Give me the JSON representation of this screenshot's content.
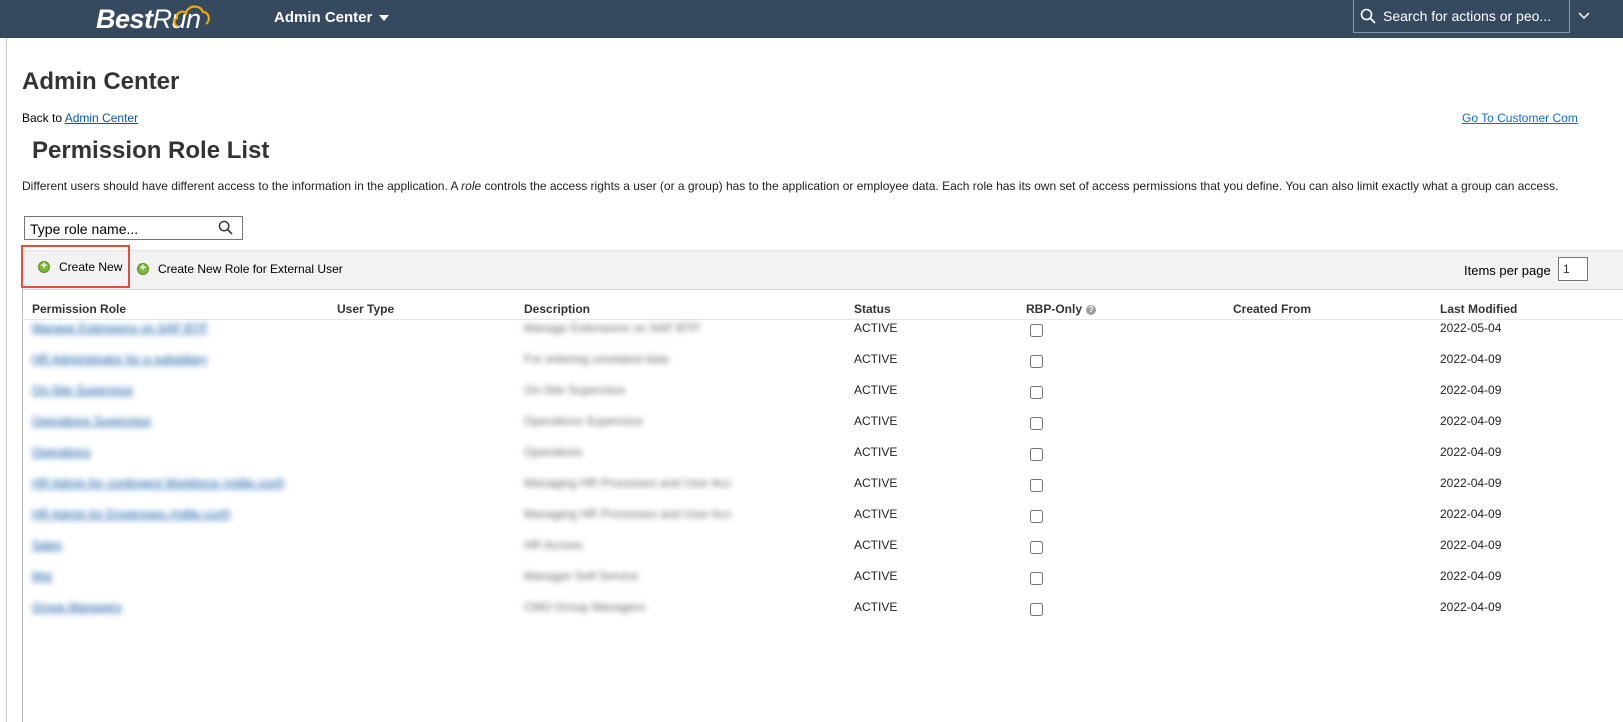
{
  "shell": {
    "logo_text_1": "Best",
    "logo_text_2": "Run",
    "app_title": "Admin Center",
    "search_placeholder": "Search for actions or peo..."
  },
  "page": {
    "heading": "Admin Center",
    "back_prefix": "Back to",
    "back_link": "Admin Center",
    "customer_link": "Go To Customer Com",
    "list_title": "Permission Role List",
    "intro_part1": "Different users should have different access to the information in the application. A ",
    "intro_italic": "role",
    "intro_part2": " controls the access rights a user (or a group) has to the application or employee data. Each role has its own set of access permissions that you define. You can also limit exactly what a group can access."
  },
  "role_search": {
    "placeholder": "Type role name..."
  },
  "toolbar": {
    "create_new": "Create New",
    "create_new_external": "Create New Role for External User",
    "items_per_page_label": "Items per page",
    "items_per_page_value": "1"
  },
  "table": {
    "columns": [
      "Permission Role",
      "User Type",
      "Description",
      "Status",
      "RBP-Only",
      "Created From",
      "Last Modified"
    ],
    "rows": [
      {
        "role": "Manage Extensions on SAP BTP",
        "description": "Manage Extensions on SAP BTP",
        "status": "ACTIVE",
        "rbp_only": false,
        "last_modified": "2022-05-04"
      },
      {
        "role": "HR Administrator for a subsidiary",
        "description": "For entering unrelated data",
        "status": "ACTIVE",
        "rbp_only": false,
        "last_modified": "2022-04-09"
      },
      {
        "role": "On-Site Supervisor",
        "description": "On-Site Supervisor",
        "status": "ACTIVE",
        "rbp_only": false,
        "last_modified": "2022-04-09"
      },
      {
        "role": "Operations Supervisor",
        "description": "Operations Supervisor",
        "status": "ACTIVE",
        "rbp_only": false,
        "last_modified": "2022-04-09"
      },
      {
        "role": "Operations",
        "description": "Operations",
        "status": "ACTIVE",
        "rbp_only": false,
        "last_modified": "2022-04-09"
      },
      {
        "role": "HR Admin for contingent Workforce (millip conf)",
        "description": "Managing HR Processes and User Acc",
        "status": "ACTIVE",
        "rbp_only": false,
        "last_modified": "2022-04-09"
      },
      {
        "role": "HR Admin for Employees (millip conf)",
        "description": "Managing HR Processes and User Acc",
        "status": "ACTIVE",
        "rbp_only": false,
        "last_modified": "2022-04-09"
      },
      {
        "role": "Sales",
        "description": "HR Access",
        "status": "ACTIVE",
        "rbp_only": false,
        "last_modified": "2022-04-09"
      },
      {
        "role": "Mgr",
        "description": "Manager Self Service",
        "status": "ACTIVE",
        "rbp_only": false,
        "last_modified": "2022-04-09"
      },
      {
        "role": "Group Managers",
        "description": "CMO Group Managers",
        "status": "ACTIVE",
        "rbp_only": false,
        "last_modified": "2022-04-09"
      }
    ]
  }
}
